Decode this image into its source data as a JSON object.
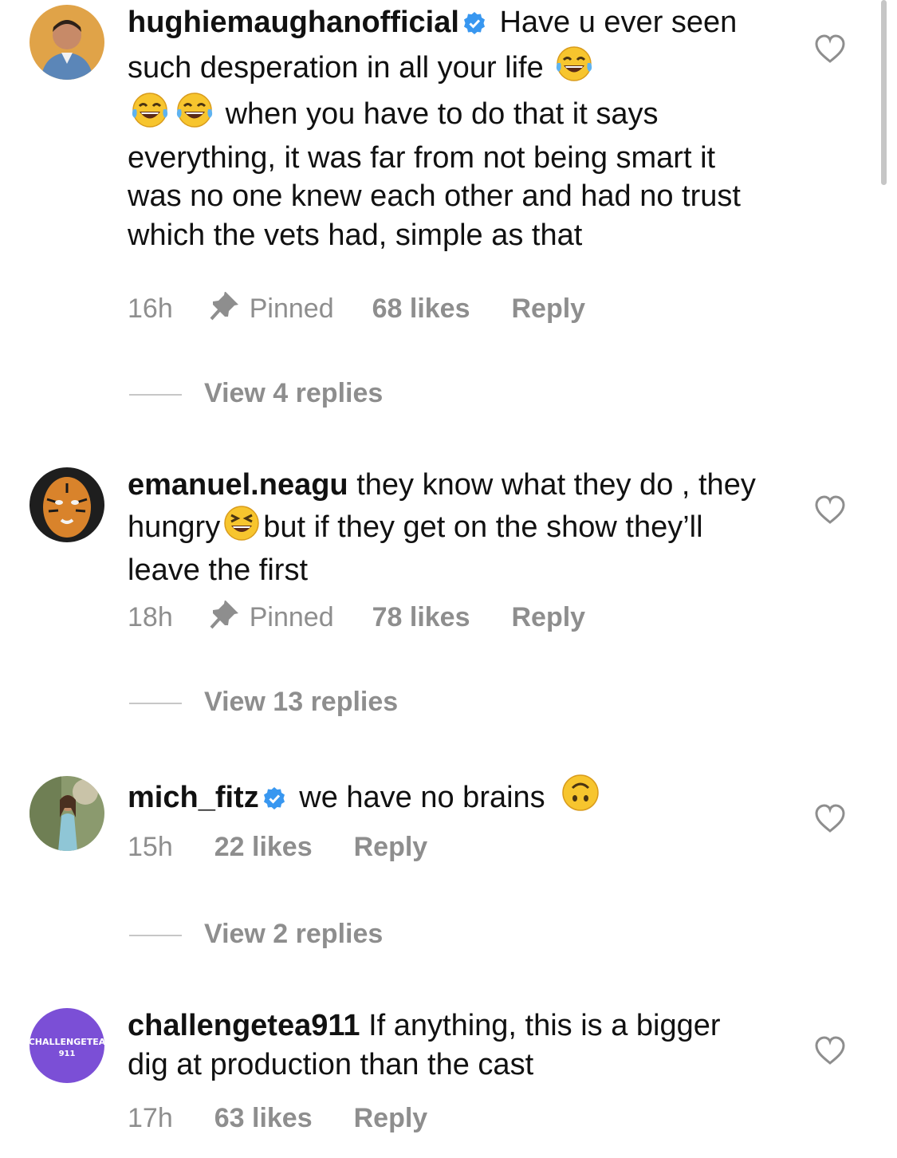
{
  "comments": [
    {
      "username": "hughiemaughanofficial",
      "verified": true,
      "text_parts": [
        "Have u ever seen such desperation in all your life",
        "when you have to do that it says everything, it was far from not being smart it was no one knew each other and had no trust which the vets had, simple as that"
      ],
      "emoji": "face-with-tears-of-joy",
      "time": "16h",
      "pinned": "Pinned",
      "likes": "68 likes",
      "reply": "Reply",
      "view_replies": "View 4 replies"
    },
    {
      "username": "emanuel.neagu",
      "verified": false,
      "text_parts": [
        "they know what they do , they hungry",
        "but if they get on the show they’ll leave the first"
      ],
      "emoji": "grinning-squinting-face",
      "time": "18h",
      "pinned": "Pinned",
      "likes": "78 likes",
      "reply": "Reply",
      "view_replies": "View 13 replies"
    },
    {
      "username": "mich_fitz",
      "verified": true,
      "text_parts": [
        "we have no brains"
      ],
      "emoji": "upside-down-face",
      "time": "15h",
      "likes": "22 likes",
      "reply": "Reply",
      "view_replies": "View 2 replies"
    },
    {
      "username": "challengetea911",
      "verified": false,
      "text_parts": [
        "If anything, this is a bigger dig at production than the cast"
      ],
      "avatar_text": [
        "CHALLENGETEA",
        "911"
      ],
      "time": "17h",
      "likes": "63 likes",
      "reply": "Reply"
    }
  ],
  "colors": {
    "verified": "#3897f0",
    "meta_gray": "#8e8e8e",
    "challengetea_avatar": "#7b4fd6"
  }
}
